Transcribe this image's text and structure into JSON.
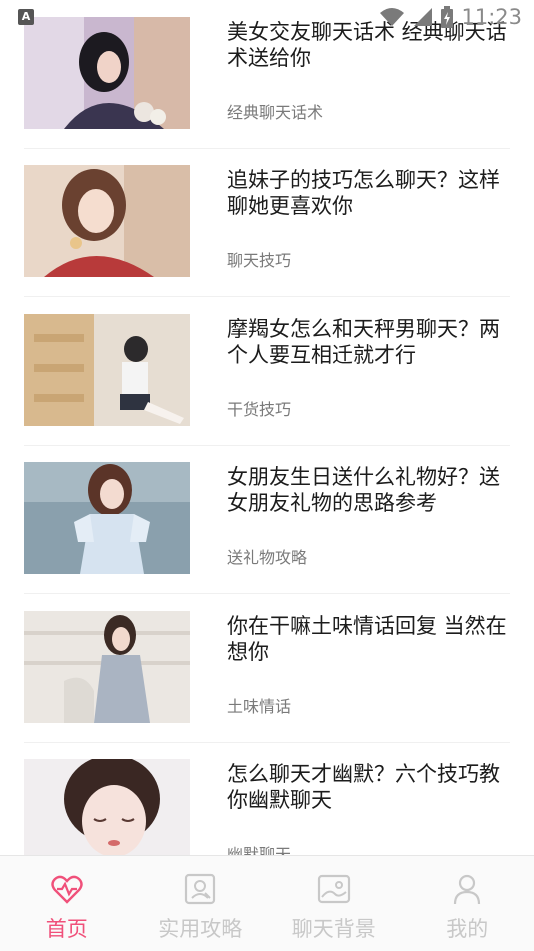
{
  "status_bar": {
    "time": "11:23",
    "notification_icon": "a-icon",
    "icons": [
      "wifi-icon",
      "signal-icon",
      "battery-charging-icon"
    ]
  },
  "articles": [
    {
      "title": "美女交友聊天话术 经典聊天话术送给你",
      "category": "经典聊天话术",
      "image": "woman-lying-icon"
    },
    {
      "title": "追妹子的技巧怎么聊天？这样聊她更喜欢你",
      "category": "聊天技巧",
      "image": "woman-red-sweater-icon"
    },
    {
      "title": "摩羯女怎么和天秤男聊天？两个人要互相迁就才行",
      "category": "干货技巧",
      "image": "woman-sitting-stairs-icon"
    },
    {
      "title": "女朋友生日送什么礼物好？送女朋友礼物的思路参考",
      "category": "送礼物攻略",
      "image": "woman-blue-dress-icon"
    },
    {
      "title": "你在干嘛土味情话回复 当然在想你",
      "category": "土味情话",
      "image": "woman-grey-dress-icon"
    },
    {
      "title": "怎么聊天才幽默？六个技巧教你幽默聊天",
      "category": "幽默聊天",
      "image": "woman-closed-eyes-icon"
    }
  ],
  "tabs": [
    {
      "label": "首页",
      "icon": "heart-pulse-icon",
      "active": true
    },
    {
      "label": "实用攻略",
      "icon": "guide-icon",
      "active": false
    },
    {
      "label": "聊天背景",
      "icon": "image-icon",
      "active": false
    },
    {
      "label": "我的",
      "icon": "user-icon",
      "active": false
    }
  ],
  "colors": {
    "accent": "#f0507a",
    "inactive": "#c8c8c8",
    "text": "#1c1c1c",
    "muted": "#7a7a7a"
  }
}
